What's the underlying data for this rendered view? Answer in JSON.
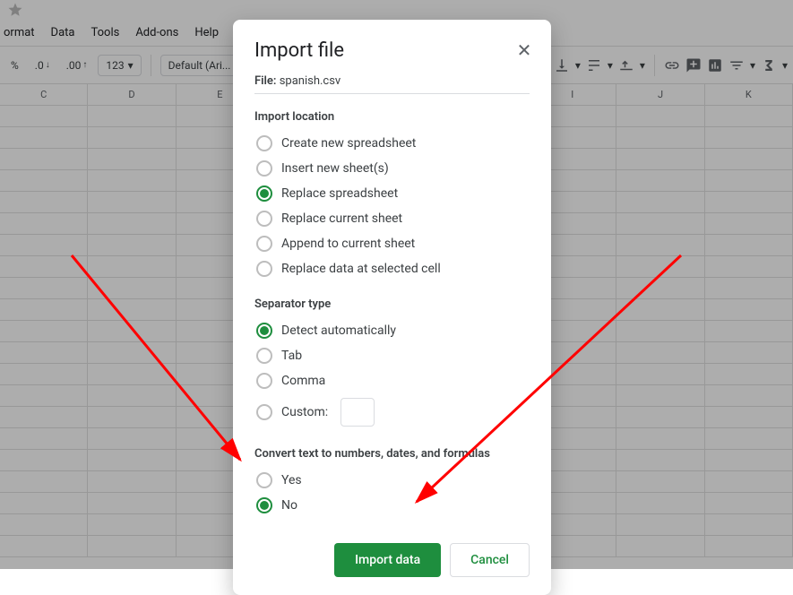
{
  "menu": {
    "items": [
      "ormat",
      "Data",
      "Tools",
      "Add-ons",
      "Help"
    ]
  },
  "toolbar": {
    "percent": "%",
    "dec_down": ".0",
    "dec_up": ".00",
    "format123": "123",
    "font": "Default (Ari..."
  },
  "columns": [
    "C",
    "D",
    "E",
    "I",
    "J",
    "K"
  ],
  "dialog": {
    "title": "Import file",
    "file_label": "File:",
    "file_name": "spanish.csv",
    "section_location": "Import location",
    "location_options": [
      {
        "label": "Create new spreadsheet",
        "selected": false
      },
      {
        "label": "Insert new sheet(s)",
        "selected": false
      },
      {
        "label": "Replace spreadsheet",
        "selected": true
      },
      {
        "label": "Replace current sheet",
        "selected": false
      },
      {
        "label": "Append to current sheet",
        "selected": false
      },
      {
        "label": "Replace data at selected cell",
        "selected": false
      }
    ],
    "section_separator": "Separator type",
    "separator_options": [
      {
        "label": "Detect automatically",
        "selected": true
      },
      {
        "label": "Tab",
        "selected": false
      },
      {
        "label": "Comma",
        "selected": false
      },
      {
        "label": "Custom:",
        "selected": false,
        "custom": true
      }
    ],
    "section_convert": "Convert text to numbers, dates, and formulas",
    "convert_options": [
      {
        "label": "Yes",
        "selected": false
      },
      {
        "label": "No",
        "selected": true
      }
    ],
    "import_btn": "Import data",
    "cancel_btn": "Cancel"
  }
}
